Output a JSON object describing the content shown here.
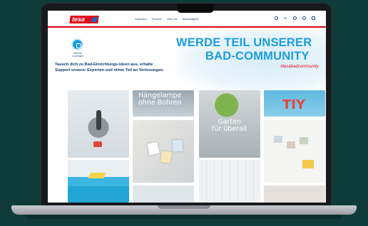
{
  "site": {
    "logo": "tesa",
    "nav": [
      "Inspiration",
      "Produkte",
      "Über uns",
      "Nachhaltigkeit"
    ],
    "lang": "DE",
    "icons": [
      "search-icon",
      "language-selector",
      "account-icon",
      "wishlist-icon",
      "cart-icon"
    ]
  },
  "hero": {
    "follow_text": "Willst du\nzu Anfügen",
    "intro": "Tausch dich zu Bad-Einrichtungs-Ideen aus, erhalte Support unserer Experten und nimm Teil an Verlosungen.",
    "title_line1": "WERDE TEIL UNSERER",
    "title_line2": "BAD-COMMUNITY",
    "hashtag": "#tesabadcommunity"
  },
  "tiles": {
    "lamp_text": "Hängelampe\nohne Bohren",
    "garden_text": "Garten\nfür überall",
    "tiy_text": "TIY"
  },
  "colors": {
    "brand_red": "#e30613",
    "accent_blue": "#1a9ee0",
    "text_navy": "#0b3c74",
    "background": "#0f3b38"
  }
}
